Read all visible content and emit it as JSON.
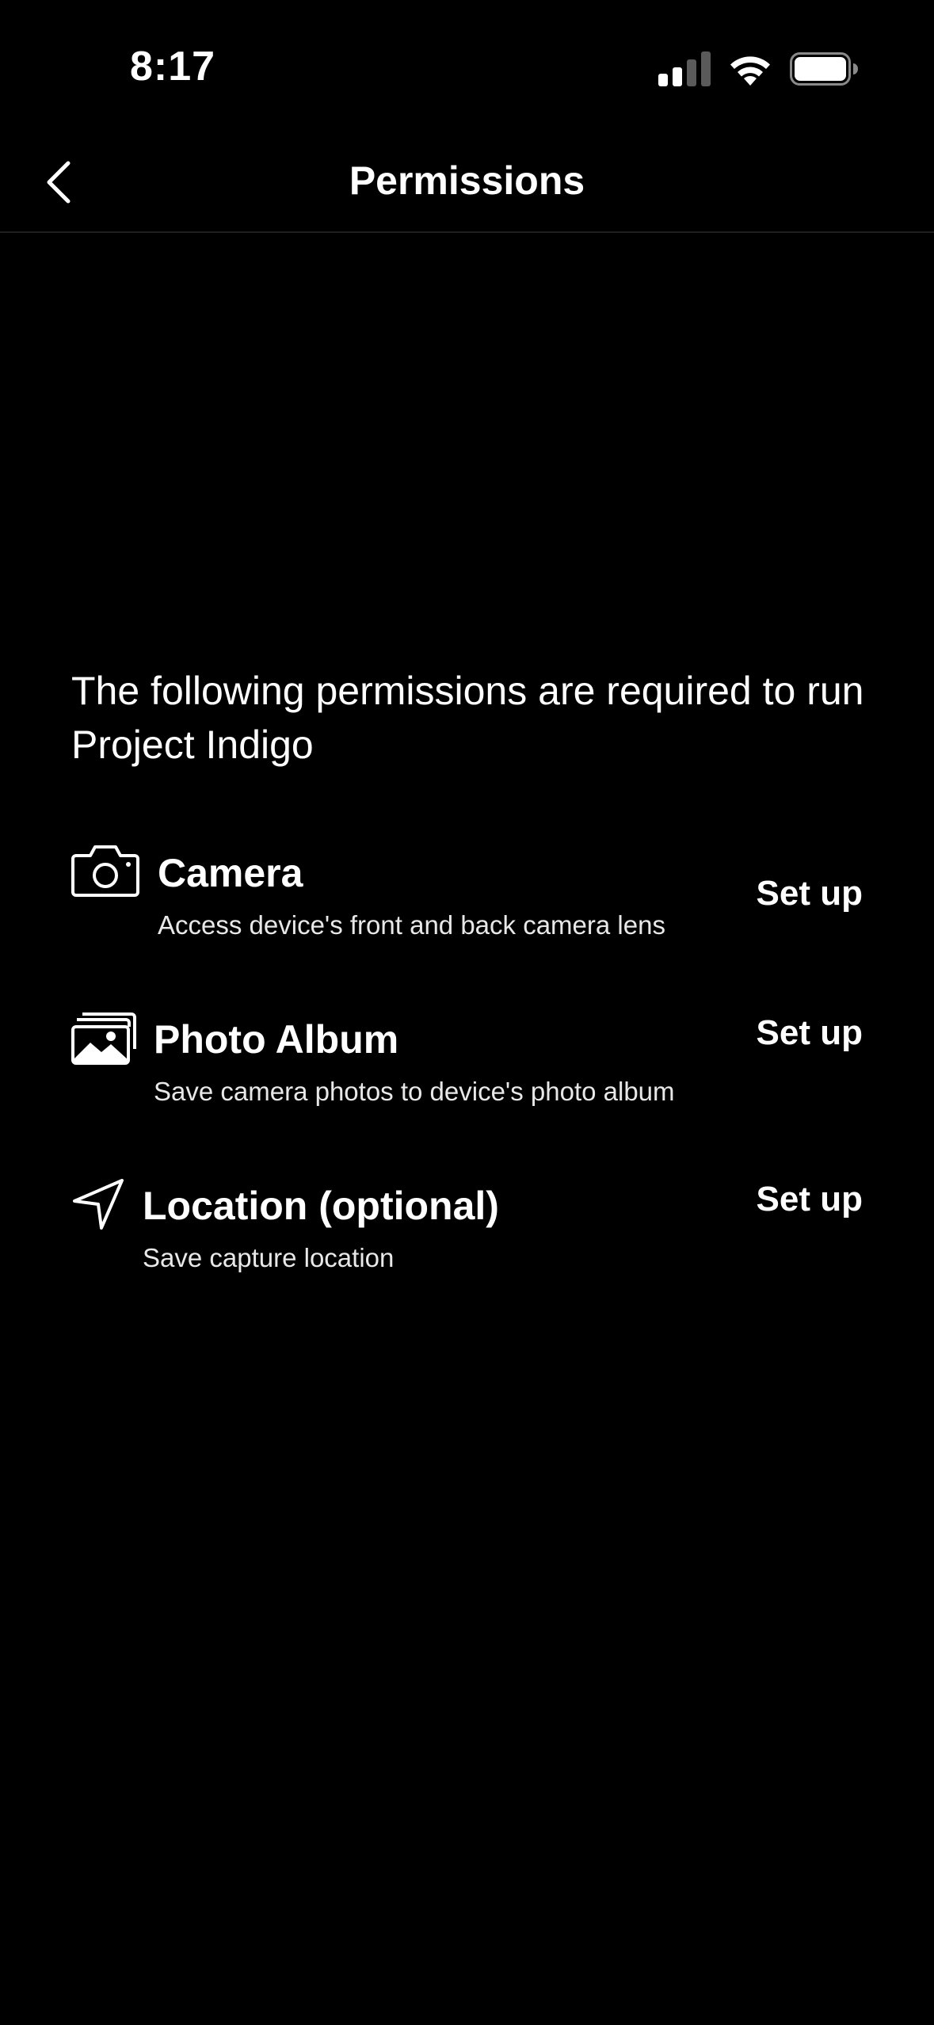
{
  "status_bar": {
    "time": "8:17",
    "icons": [
      "signal-icon",
      "wifi-icon",
      "battery-icon"
    ]
  },
  "header": {
    "title": "Permissions",
    "back_icon": "chevron-left-icon"
  },
  "intro": {
    "text": "The following permissions are required to run Project Indigo"
  },
  "permissions": [
    {
      "icon": "camera-icon",
      "title": "Camera",
      "description": "Access device's front and back camera lens",
      "action_label": "Set up"
    },
    {
      "icon": "photo-album-icon",
      "title": "Photo Album",
      "description": "Save camera photos to device's photo album",
      "action_label": "Set up"
    },
    {
      "icon": "location-arrow-icon",
      "title": "Location (optional)",
      "description": "Save capture location",
      "action_label": "Set up"
    }
  ],
  "colors": {
    "background": "#000000",
    "text": "#ffffff",
    "divider": "#1f1f1f"
  }
}
